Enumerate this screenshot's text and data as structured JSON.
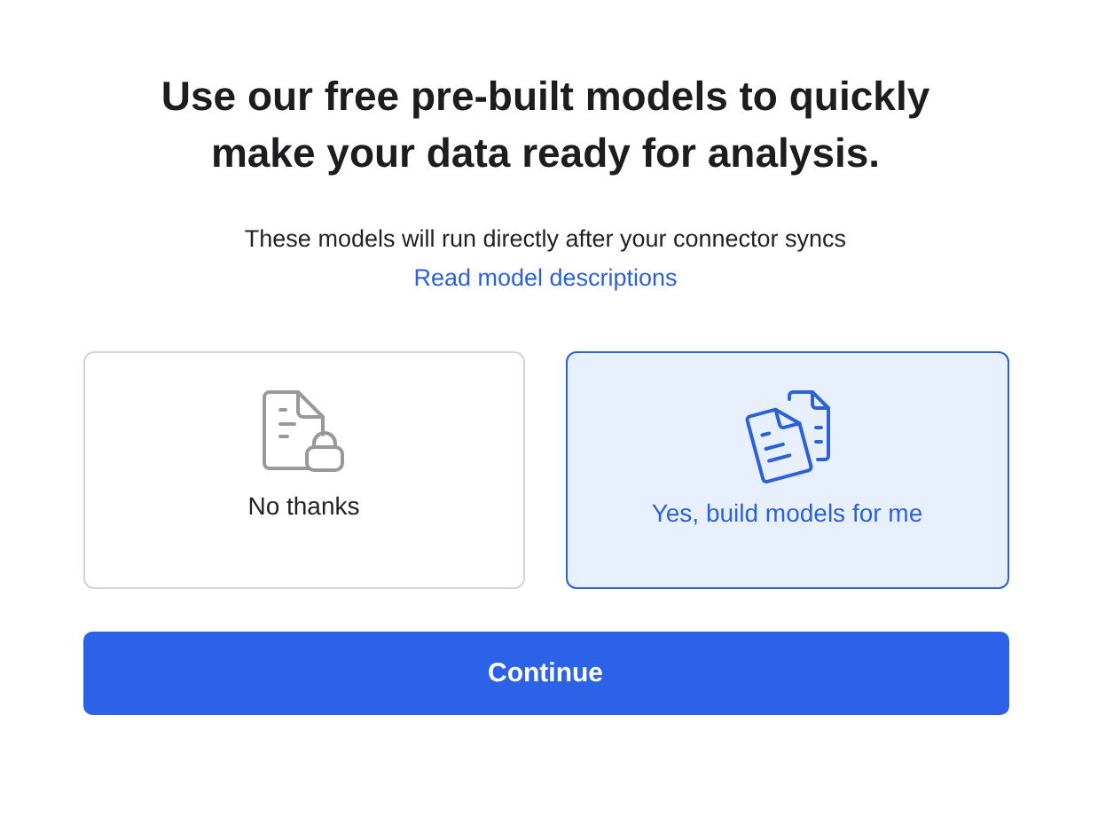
{
  "heading": "Use our free pre-built models to quickly make your data ready for analysis.",
  "subtitle": "These models will run directly after your connector syncs",
  "link": "Read model descriptions",
  "options": [
    {
      "kind": "decline",
      "label": "No thanks",
      "selected": false
    },
    {
      "kind": "accept",
      "label": "Yes, build models for me",
      "selected": true
    }
  ],
  "button": "Continue"
}
